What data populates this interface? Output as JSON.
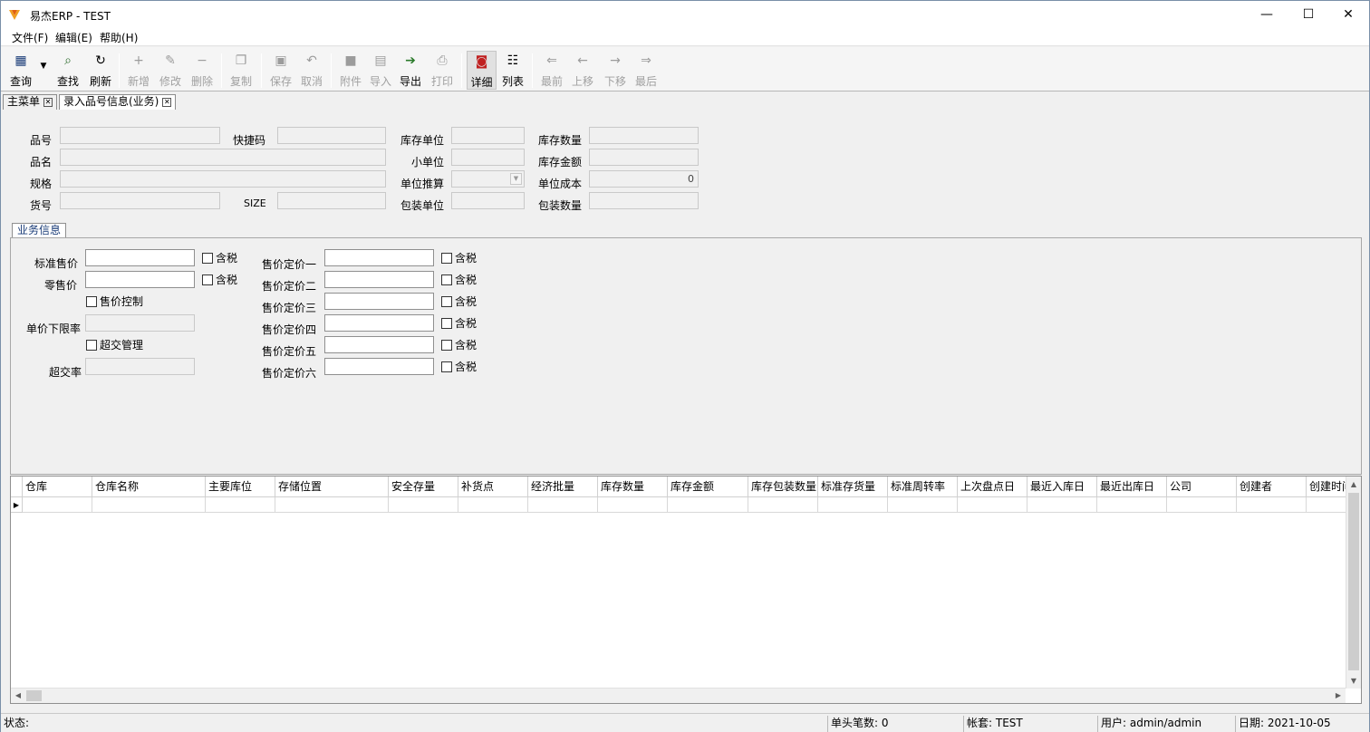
{
  "window": {
    "title": "易杰ERP - TEST",
    "minimize": "—",
    "maximize": "☐",
    "close": "✕"
  },
  "menu": {
    "file": "文件(F)",
    "edit": "编辑(E)",
    "help": "帮助(H)"
  },
  "toolbar": {
    "query": "查询",
    "find": "查找",
    "refresh": "刷新",
    "add": "新增",
    "modify": "修改",
    "delete": "删除",
    "copy": "复制",
    "save": "保存",
    "cancel": "取消",
    "attach": "附件",
    "import": "导入",
    "export": "导出",
    "print": "打印",
    "detail": "详细",
    "list": "列表",
    "first": "最前",
    "prev": "上移",
    "next": "下移",
    "last": "最后"
  },
  "tabs": [
    {
      "label": "主菜单"
    },
    {
      "label": "录入品号信息(业务)"
    }
  ],
  "form": {
    "item_no": "品号",
    "quick_code": "快捷码",
    "stock_unit": "库存单位",
    "stock_qty": "库存数量",
    "item_name": "品名",
    "small_unit": "小单位",
    "stock_amount": "库存金额",
    "spec": "规格",
    "unit_calc": "单位推算",
    "unit_cost": "单位成本",
    "unit_cost_value": "0",
    "goods_no": "货号",
    "size": "SIZE",
    "pack_unit": "包装单位",
    "pack_qty": "包装数量"
  },
  "business": {
    "tab_label": "业务信息",
    "std_price": "标准售价",
    "retail_price": "零售价",
    "price_control": "售价控制",
    "min_price_rate": "单价下限率",
    "over_manage": "超交管理",
    "over_rate": "超交率",
    "tax_included": "含税",
    "price_levels": [
      "售价定价一",
      "售价定价二",
      "售价定价三",
      "售价定价四",
      "售价定价五",
      "售价定价六"
    ]
  },
  "grid": {
    "columns": [
      "仓库",
      "仓库名称",
      "主要库位",
      "存储位置",
      "安全存量",
      "补货点",
      "经济批量",
      "库存数量",
      "库存金额",
      "库存包装数量",
      "标准存货量",
      "标准周转率",
      "上次盘点日",
      "最近入库日",
      "最近出库日",
      "公司",
      "创建者",
      "创建时间"
    ]
  },
  "status": {
    "state": "状态:",
    "count": "单头笔数: 0",
    "account": "帐套: TEST",
    "user": "用户: admin/admin",
    "date": "日期: 2021-10-05"
  }
}
